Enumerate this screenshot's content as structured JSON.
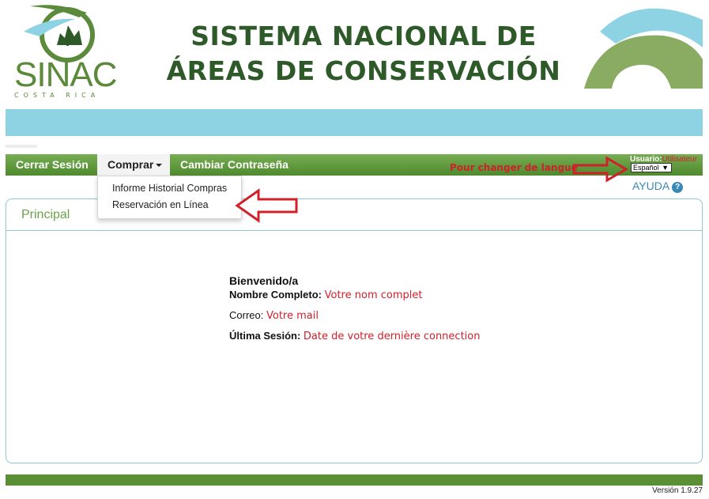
{
  "header": {
    "logo_text": "SINAC",
    "logo_subtext": "COSTA RICA",
    "title_line1": "SISTEMA NACIONAL DE",
    "title_line2": "ÁREAS DE CONSERVACIÓN"
  },
  "nav": {
    "items": [
      {
        "label": "Cerrar Sesión"
      },
      {
        "label": "Comprar"
      },
      {
        "label": "Cambiar Contraseña"
      }
    ],
    "user_label": "Usuario:",
    "user_value": "Utilisateur",
    "language_selected": "Español",
    "help_label": "AYUDA",
    "help_icon": "?"
  },
  "dropdown": {
    "items": [
      {
        "label": "Informe Historial Compras"
      },
      {
        "label": "Reservación en Línea"
      }
    ]
  },
  "annotations": {
    "language_note": "Pour changer de langue"
  },
  "panel": {
    "title": "Principal",
    "welcome": "Bienvenido/a",
    "full_name_label": "Nombre Completo:",
    "full_name_value": "Votre nom complet",
    "email_label": "Correo:",
    "email_value": "Votre mail",
    "last_session_label": "Última Sesión:",
    "last_session_value": "Date de votre dernière connection"
  },
  "footer": {
    "version": "Versión 1.9.27"
  },
  "colors": {
    "green_nav": "#5b8f35",
    "light_blue": "#8dd3e3",
    "annotation_red": "#d0202a",
    "title_green": "#2e5a2a"
  }
}
